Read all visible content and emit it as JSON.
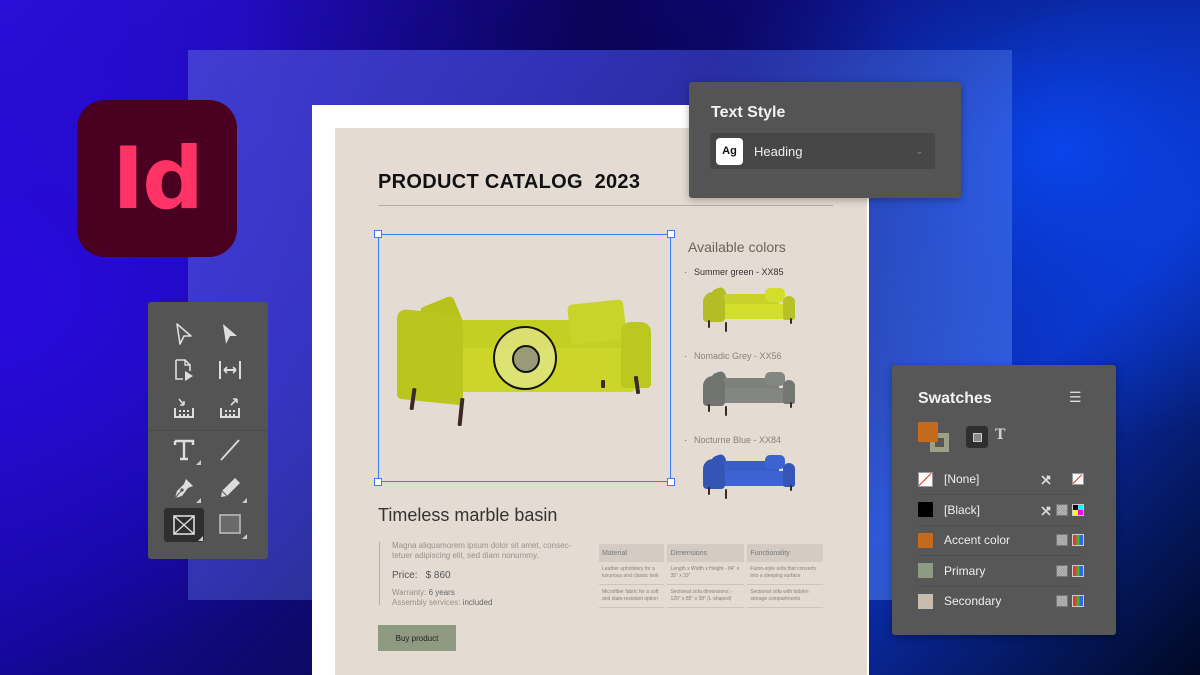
{
  "app": {
    "logo_text": "Id",
    "logo_bg": "#4a0020",
    "logo_fg": "#ff3366"
  },
  "document": {
    "title": "PRODUCT CATALOG  2023",
    "available_colors_title": "Available colors",
    "color_options": [
      {
        "label": "Summer green - XX85",
        "swatch": "#c8d22a"
      },
      {
        "label": "Nomadic Grey - XX56",
        "swatch": "#7e807c"
      },
      {
        "label": "Nocturne Blue - XX84",
        "swatch": "#3a5ec8"
      }
    ],
    "product_name": "Timeless marble basin",
    "description": "Magna aliquamorem ipsum dolor sit amet, consec-tetuer adipiscing elit, sed diam nonummy.",
    "price_label": "Price:",
    "price_value": "$ 860",
    "warranty_label": "Warranty:",
    "warranty_value": "6 years",
    "assembly_label": "Assembly services:",
    "assembly_value": "included",
    "buy_button": "Buy product",
    "spec_table": {
      "headers": [
        "Material",
        "Dimensions",
        "Functionality"
      ],
      "rows": [
        [
          "Leather upholstery for a luxurious and classic look",
          "Length x Width x Height - 84\" x 35\" x 33\"",
          "Futon-style sofa that converts into a sleeping surface"
        ],
        [
          "Microfiber fabric for a soft and stain-resistant option",
          "Sectional sofa dimensions: - 120\" x 85\" x 38\" (L-shaped)",
          "Sectional sofa with hidden storage compartments"
        ]
      ]
    }
  },
  "text_style_panel": {
    "title": "Text Style",
    "preview": "Ag",
    "selected": "Heading"
  },
  "tools_panel": {
    "tools": [
      {
        "name": "selection-tool"
      },
      {
        "name": "direct-selection-tool"
      },
      {
        "name": "page-tool"
      },
      {
        "name": "gap-tool"
      },
      {
        "name": "content-collector-tool"
      },
      {
        "name": "content-placer-tool"
      },
      {
        "name": "type-tool"
      },
      {
        "name": "line-tool"
      },
      {
        "name": "pen-tool"
      },
      {
        "name": "pencil-tool"
      },
      {
        "name": "rectangle-frame-tool",
        "active": true
      },
      {
        "name": "rectangle-tool"
      }
    ]
  },
  "swatches_panel": {
    "title": "Swatches",
    "fill_color": "#c46a1c",
    "stroke_color": "#9ba087",
    "swatches": [
      {
        "name": "[None]",
        "color": "none",
        "icons": [
          "no-edit",
          "none"
        ]
      },
      {
        "name": "[Black]",
        "color": "#000000",
        "icons": [
          "no-edit",
          "process",
          "cmyk"
        ]
      },
      {
        "name": "Accent color",
        "color": "#c46a1c",
        "icons": [
          "process",
          "rgb"
        ]
      },
      {
        "name": "Primary",
        "color": "#8e9a82",
        "icons": [
          "process",
          "rgb"
        ]
      },
      {
        "name": "Secondary",
        "color": "#c9bcae",
        "icons": [
          "process",
          "rgb"
        ]
      }
    ]
  }
}
